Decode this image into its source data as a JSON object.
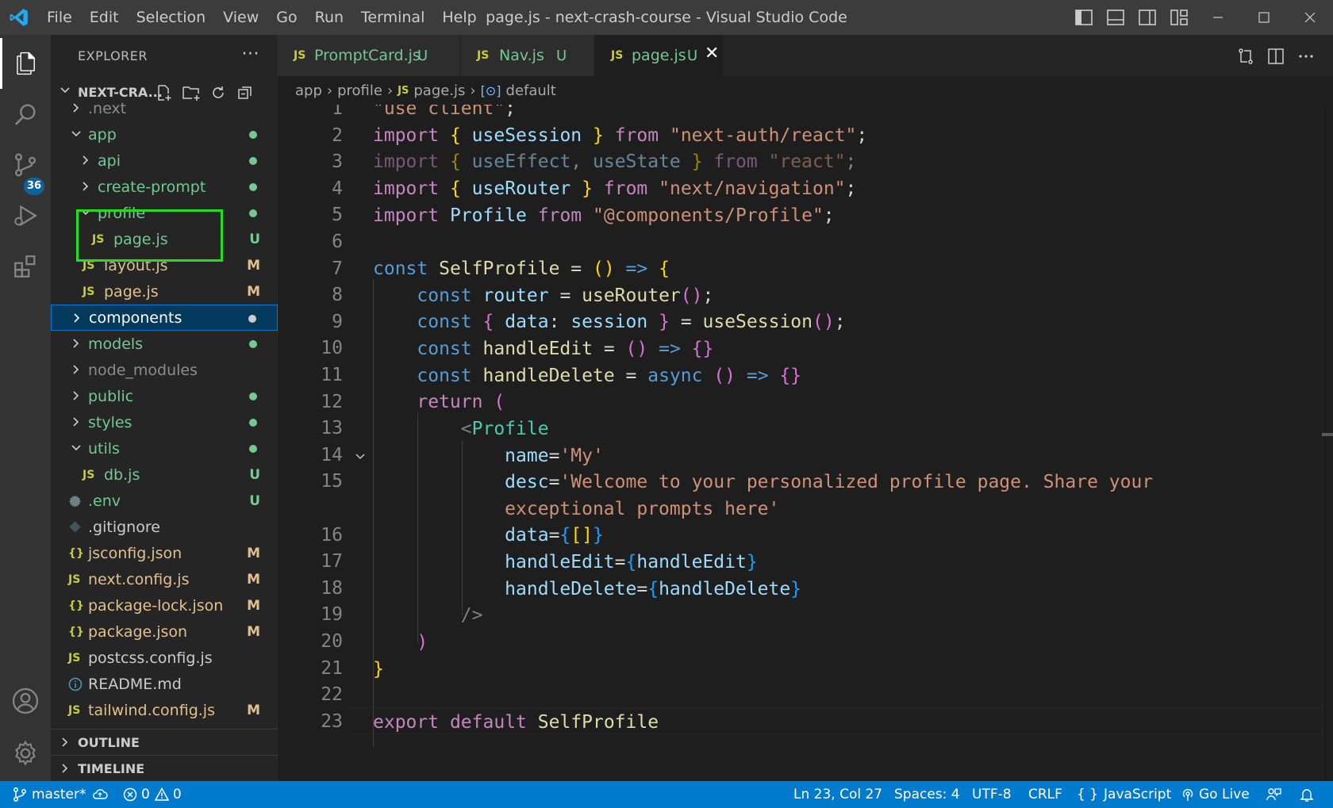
{
  "titlebar": {
    "menu": [
      "File",
      "Edit",
      "Selection",
      "View",
      "Go",
      "Run",
      "Terminal",
      "Help"
    ],
    "title": "page.js - next-crash-course - Visual Studio Code"
  },
  "activitybar": {
    "scm_badge": "36"
  },
  "sidebar": {
    "header": "EXPLORER",
    "more": "···",
    "project": "NEXT-CRA...",
    "tree": [
      {
        "label": ".next",
        "status": ""
      },
      {
        "label": "app",
        "status": ""
      },
      {
        "label": "api",
        "status": ""
      },
      {
        "label": "create-prompt",
        "status": ""
      },
      {
        "label": "profile",
        "status": ""
      },
      {
        "label": "page.js",
        "status": "U",
        "icon": "JS"
      },
      {
        "label": "layout.js",
        "status": "M",
        "icon": "JS"
      },
      {
        "label": "page.js",
        "status": "M",
        "icon": "JS"
      },
      {
        "label": "components",
        "status": ""
      },
      {
        "label": "models",
        "status": ""
      },
      {
        "label": "node_modules",
        "status": ""
      },
      {
        "label": "public",
        "status": ""
      },
      {
        "label": "styles",
        "status": ""
      },
      {
        "label": "utils",
        "status": ""
      },
      {
        "label": "db.js",
        "status": "U",
        "icon": "JS"
      },
      {
        "label": ".env",
        "status": "U"
      },
      {
        "label": ".gitignore",
        "status": ""
      },
      {
        "label": "jsconfig.json",
        "status": "M",
        "icon": "{}"
      },
      {
        "label": "next.config.js",
        "status": "M",
        "icon": "JS"
      },
      {
        "label": "package-lock.json",
        "status": "M",
        "icon": "{}"
      },
      {
        "label": "package.json",
        "status": "M",
        "icon": "{}"
      },
      {
        "label": "postcss.config.js",
        "status": "",
        "icon": "JS"
      },
      {
        "label": "README.md",
        "status": ""
      },
      {
        "label": "tailwind.config.js",
        "status": "M",
        "icon": "JS"
      }
    ],
    "outline": "OUTLINE",
    "timeline": "TIMELINE"
  },
  "tabs": [
    {
      "icon": "JS",
      "name": "PromptCard.js",
      "status": "U"
    },
    {
      "icon": "JS",
      "name": "Nav.js",
      "status": "U"
    },
    {
      "icon": "JS",
      "name": "page.js",
      "status": "U"
    }
  ],
  "breadcrumb": {
    "parts": [
      "app",
      "profile",
      "page.js",
      "default"
    ],
    "file_icon": "JS"
  },
  "editor": {
    "line_numbers": [
      "1",
      "2",
      "3",
      "4",
      "5",
      "6",
      "7",
      "8",
      "9",
      "10",
      "11",
      "12",
      "13",
      "14",
      "15",
      "",
      "16",
      "17",
      "18",
      "19",
      "20",
      "21",
      "22",
      "23"
    ]
  },
  "statusbar": {
    "branch": "master*",
    "errors": "0",
    "warnings": "0",
    "position": "Ln 23, Col 27",
    "spaces": "Spaces: 4",
    "encoding": "UTF-8",
    "eol": "CRLF",
    "language": "JavaScript",
    "golive": "Go Live"
  },
  "colors": {
    "statusbar": "#007acc",
    "highlight_box": "#22dd22",
    "untracked": "#73c991",
    "modified": "#e2c08d"
  }
}
